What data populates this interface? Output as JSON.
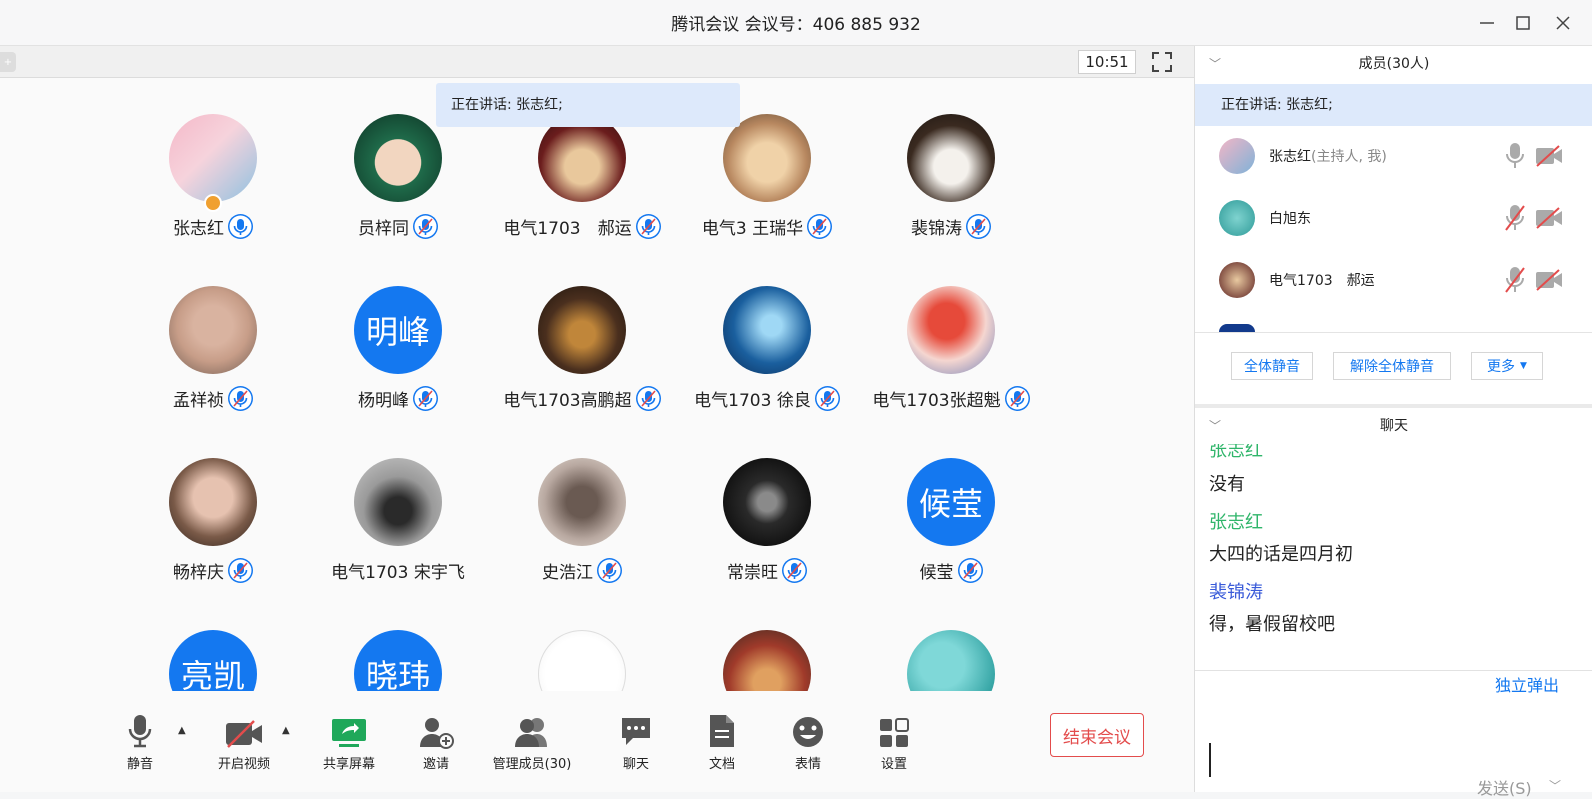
{
  "window": {
    "title": "腾讯会议 会议号：406 885 932"
  },
  "toolstrip": {
    "clock": "10:51"
  },
  "speaking_banner": "正在讲话: 张志红;",
  "participants": [
    {
      "name": "张志红",
      "avatar": "photo",
      "color": "#e8a0b0",
      "host": true
    },
    {
      "name": "员梓同",
      "avatar": "anime"
    },
    {
      "name": "电气1703　郝运",
      "avatar": "photo"
    },
    {
      "name": "电气3  王瑞华",
      "avatar": "dog"
    },
    {
      "name": "裴锦涛",
      "avatar": "photo"
    },
    {
      "name": "孟祥祯",
      "avatar": "photo"
    },
    {
      "name": "杨明峰",
      "avatar": "text",
      "text": "明峰"
    },
    {
      "name": "电气1703高鹏超",
      "avatar": "photo"
    },
    {
      "name": "电气1703  徐良",
      "avatar": "photo"
    },
    {
      "name": "电气1703张超魁",
      "avatar": "anime"
    },
    {
      "name": "畅梓庆",
      "avatar": "photo"
    },
    {
      "name": "电气1703 宋宇飞",
      "avatar": "photo",
      "nomic": true
    },
    {
      "name": "史浩江",
      "avatar": "photo"
    },
    {
      "name": "常崇旺",
      "avatar": "headphones"
    },
    {
      "name": "候莹",
      "avatar": "text",
      "text": "候莹"
    },
    {
      "name": "",
      "avatar": "text",
      "text": "亮凯"
    },
    {
      "name": "",
      "avatar": "text",
      "text": "晓玮"
    },
    {
      "name": "",
      "avatar": "sketch"
    },
    {
      "name": "",
      "avatar": "photo"
    },
    {
      "name": "",
      "avatar": "pool"
    }
  ],
  "toolbar": {
    "mute": "静音",
    "video": "开启视频",
    "share": "共享屏幕",
    "invite": "邀请",
    "manage": "管理成员(30)",
    "chat": "聊天",
    "docs": "文档",
    "emoji": "表情",
    "settings": "设置",
    "end": "结束会议"
  },
  "members_panel": {
    "title": "成员(30人)",
    "speaking": "正在讲话: 张志红;",
    "list": [
      {
        "name": "张志红",
        "sub": "(主持人, 我)",
        "muted": false
      },
      {
        "name": "白旭东",
        "sub": "",
        "muted": true
      },
      {
        "name": "电气1703　郝运",
        "sub": "",
        "muted": true
      }
    ],
    "mute_all": "全体静音",
    "unmute_all": "解除全体静音",
    "more": "更多"
  },
  "chat_panel": {
    "title": "聊天",
    "messages": [
      {
        "sender": "张志红",
        "text": "没有",
        "color": "#2fb56a"
      },
      {
        "sender": "张志红",
        "text": "大四的话是四月初",
        "color": "#2fb56a"
      },
      {
        "sender": "裴锦涛",
        "text": "得，暑假留校吧",
        "color": "#3a5bd9"
      }
    ],
    "popout": "独立弹出",
    "send": "发送(S)"
  },
  "colors": {
    "accent": "#1478f0",
    "danger": "#e34c4c",
    "highlight": "#dde9fb"
  }
}
